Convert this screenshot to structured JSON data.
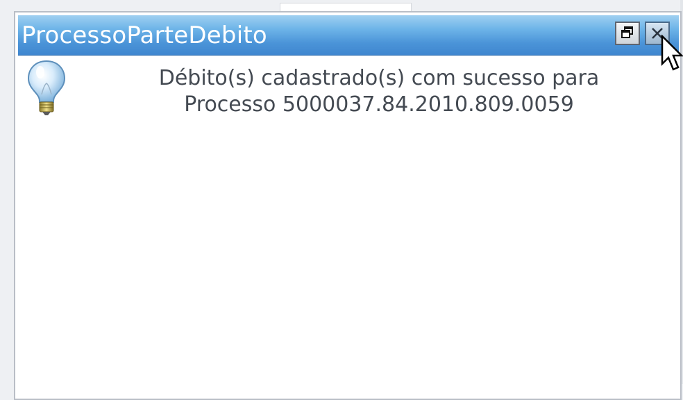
{
  "window": {
    "title": "ProcessoParteDebito"
  },
  "message": {
    "line1": "Débito(s) cadastrado(s) com sucesso para",
    "line2": "Processo 5000037.84.2010.809.0059"
  },
  "icons": {
    "restore": "restore-window-icon",
    "close": "close-icon",
    "message": "lightbulb-icon"
  },
  "colors": {
    "titlebar_top": "#9fd0f1",
    "titlebar_bottom": "#3f86cf",
    "title_text": "#ffffff",
    "message_text": "#444a52"
  }
}
